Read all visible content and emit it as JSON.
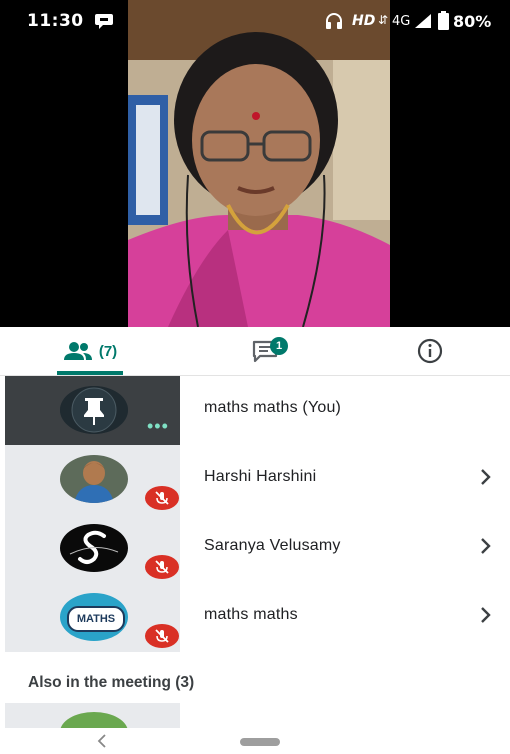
{
  "status_bar": {
    "time": "11:30",
    "hd": "HD",
    "network": "4G",
    "battery": "80%"
  },
  "tabs": {
    "people_count": "(7)",
    "chat_badge": "1"
  },
  "participants": [
    {
      "name": "maths maths (You)",
      "avatar_icon": "pin-icon"
    },
    {
      "name": "Harshi Harshini",
      "avatar_icon": "child-photo"
    },
    {
      "name": "Saranya Velusamy",
      "avatar_icon": "s-monogram"
    },
    {
      "name": "maths maths",
      "avatar_icon": "maths-logo"
    }
  ],
  "maths_logo_text": "MATHS",
  "also_in_meeting": "Also in the meeting (3)",
  "colors": {
    "accent": "#00796b",
    "mute_red": "#d93025",
    "self_tile": "#3c4043",
    "tile": "#e8eaed"
  }
}
